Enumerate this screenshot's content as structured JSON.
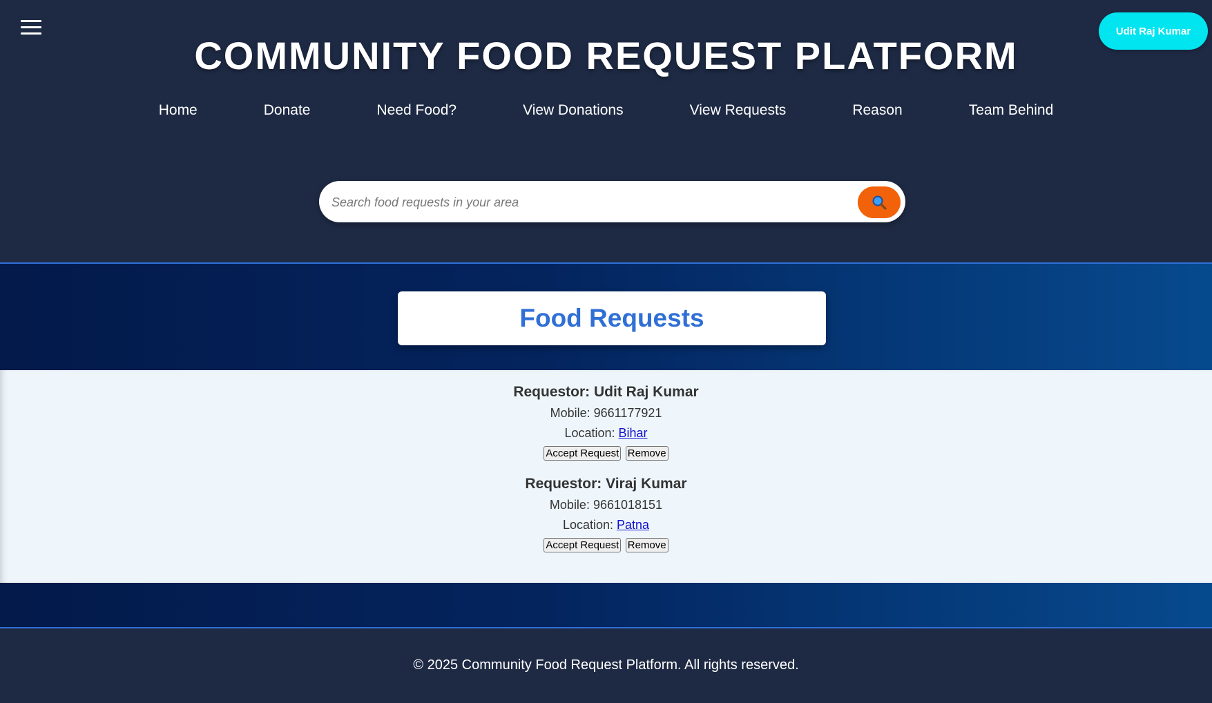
{
  "header": {
    "title": "COMMUNITY FOOD REQUEST PLATFORM",
    "user_button": "Udit Raj Kumar",
    "nav": [
      "Home",
      "Donate",
      "Need Food?",
      "View Donations",
      "View Requests",
      "Reason",
      "Team Behind"
    ],
    "search_placeholder": "Search food requests in your area"
  },
  "banner": {
    "title": "Food Requests"
  },
  "requests": [
    {
      "requestor": "Requestor: Udit Raj Kumar",
      "mobile": "Mobile: 9661177921",
      "location_label": "Location:",
      "location": "Bihar",
      "accept_label": "Accept Request",
      "remove_label": "Remove"
    },
    {
      "requestor": "Requestor: Viraj Kumar",
      "mobile": "Mobile: 9661018151",
      "location_label": "Location:",
      "location": "Patna",
      "accept_label": "Accept Request",
      "remove_label": "Remove"
    }
  ],
  "footer": {
    "text": "© 2025 Community Food Request Platform. All rights reserved."
  },
  "colors": {
    "header_bg": "#1e2a44",
    "user_button_bg": "#00e5f0",
    "search_button_bg": "#f2620a",
    "banner_title": "#2f6fd6",
    "requests_bg": "#eef6fc"
  },
  "icons": {
    "menu": "hamburger-menu-icon",
    "search": "search-icon"
  }
}
